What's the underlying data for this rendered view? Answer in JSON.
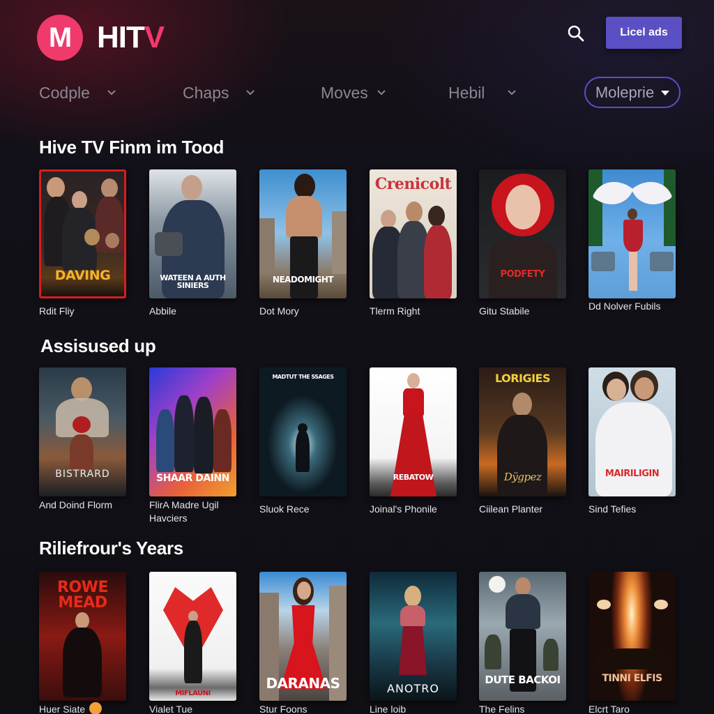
{
  "header": {
    "logo_letter": "M",
    "brand_prefix": "HIT",
    "brand_suffix": "V",
    "search_icon": "search-icon",
    "cta_label": "Licel ads"
  },
  "nav": {
    "items": [
      {
        "label": "Codple"
      },
      {
        "label": "Chaps"
      },
      {
        "label": "Moves"
      },
      {
        "label": "Hebil"
      }
    ],
    "pill": {
      "label": "Moleprie"
    }
  },
  "colors": {
    "brand_pink": "#f03a6c",
    "accent_purple": "#5b4fc4",
    "background": "#0f0f14"
  },
  "sections": [
    {
      "title": "Hive TV Finm im Tood",
      "items": [
        {
          "title": "Rdit Fliy",
          "poster_text": "DAVING"
        },
        {
          "title": "Abbile",
          "poster_text": "WATEEN A AUTH SINIERS"
        },
        {
          "title": "Dot Mory",
          "poster_text": "NEADOMIGHT"
        },
        {
          "title": "Tlerm Right",
          "poster_text": "Crenicolt"
        },
        {
          "title": "Gitu Stabile",
          "poster_text": "PODFETY"
        },
        {
          "title": "Dd Nolver Fubils",
          "poster_text": ""
        }
      ]
    },
    {
      "title": "Assisused up",
      "items": [
        {
          "title": "And Doind Florm",
          "poster_text": "BISTRARD"
        },
        {
          "title": "FlirA Madre Ugil Havciers",
          "poster_text": "SHAAR DAINN"
        },
        {
          "title": "Sluok Rece",
          "poster_text": "MADTUT THE SSAGES"
        },
        {
          "title": "Joinal's Phonile",
          "poster_text": "REBATOW"
        },
        {
          "title": "Ciilean Planter",
          "poster_text": "LORIGIES"
        },
        {
          "title": "Sind Tefies",
          "poster_text": "MAIRILIGIN"
        }
      ]
    },
    {
      "title": "Riliefrour's Years",
      "items": [
        {
          "title": "Huer Siate",
          "poster_text": "ROWE MEAD",
          "badge": "emoji-face"
        },
        {
          "title": "Vialet Tue",
          "poster_text": "MIFLAUNI"
        },
        {
          "title": "Stur Foons",
          "poster_text": "DARANAS"
        },
        {
          "title": "Line loib",
          "poster_text": "ANOTRO"
        },
        {
          "title": "The Felins",
          "poster_text": "DUTE BACKOI"
        },
        {
          "title": "Elcrt Taro",
          "poster_text": "TINNI ELFIS"
        }
      ]
    }
  ]
}
